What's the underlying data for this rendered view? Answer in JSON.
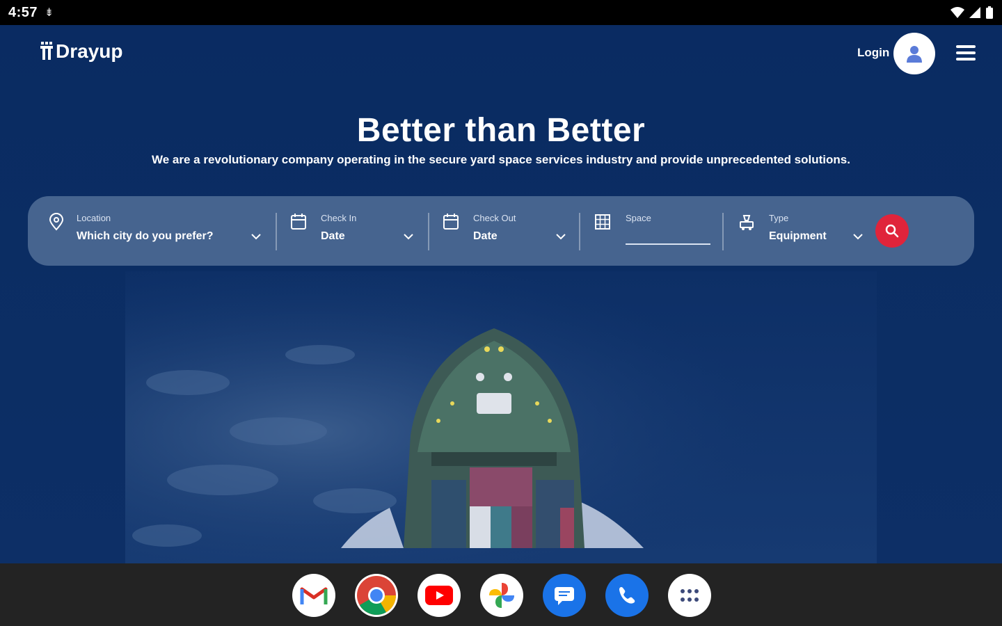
{
  "status_bar": {
    "time": "4:57",
    "usb_glyph": "⇟"
  },
  "header": {
    "brand": "Drayup",
    "login_label": "Login"
  },
  "hero": {
    "title": "Better than Better",
    "subtitle": "We are a revolutionary company operating in the secure yard space services industry and provide unprecedented solutions."
  },
  "search": {
    "location": {
      "label": "Location",
      "value": "Which city do you prefer?"
    },
    "check_in": {
      "label": "Check In",
      "value": "Date"
    },
    "check_out": {
      "label": "Check Out",
      "value": "Date"
    },
    "space": {
      "label": "Space",
      "value": ""
    },
    "type": {
      "label": "Type",
      "value": "Equipment"
    }
  },
  "dock": {
    "apps": [
      "Gmail",
      "Chrome",
      "YouTube",
      "Photos",
      "Messages",
      "Phone",
      "App drawer"
    ]
  },
  "colors": {
    "accent": "#e0243b",
    "background": "#0b2a5e"
  }
}
